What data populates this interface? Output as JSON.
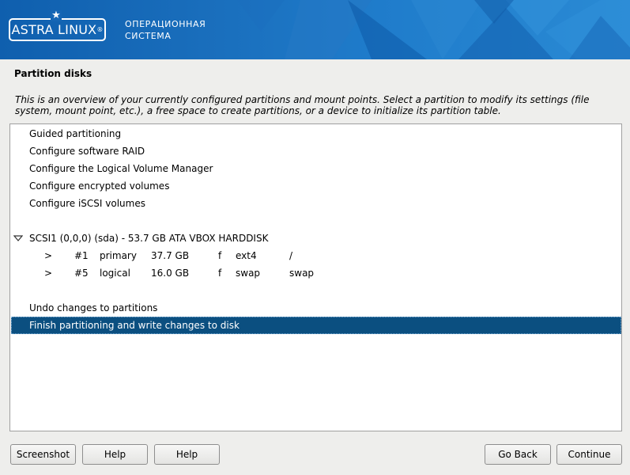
{
  "banner": {
    "logo_text": "ASTRA LINUX",
    "logo_registered": "®",
    "subtitle_line1": "ОПЕРАЦИОННАЯ",
    "subtitle_line2": "СИСТЕМА",
    "accent_color": "#1a6fbd"
  },
  "page": {
    "title": "Partition disks",
    "description": "This is an overview of your currently configured partitions and mount points. Select a partition to modify its settings (file system, mount point, etc.), a free space to create partitions, or a device to initialize its partition table."
  },
  "menu": {
    "guided": "Guided partitioning",
    "raid": "Configure software RAID",
    "lvm": "Configure the Logical Volume Manager",
    "encrypted": "Configure encrypted volumes",
    "iscsi": "Configure iSCSI volumes",
    "undo": "Undo changes to partitions",
    "finish": "Finish partitioning and write changes to disk"
  },
  "disk": {
    "label": "SCSI1 (0,0,0) (sda) - 53.7 GB ATA VBOX HARDDISK",
    "toggle_icon": "triangle-down-icon",
    "partitions": [
      {
        "arrow": ">",
        "number": "#1",
        "type": "primary",
        "size": "37.7 GB",
        "flag": "f",
        "fs": "ext4",
        "mount": "/"
      },
      {
        "arrow": ">",
        "number": "#5",
        "type": "logical",
        "size": "16.0 GB",
        "flag": "f",
        "fs": "swap",
        "mount": "swap"
      }
    ]
  },
  "buttons": {
    "screenshot": "Screenshot",
    "help1": "Help",
    "help2": "Help",
    "back": "Go Back",
    "continue": "Continue"
  },
  "colors": {
    "selected_bg": "#0b4f80",
    "window_bg": "#eeeeec"
  }
}
